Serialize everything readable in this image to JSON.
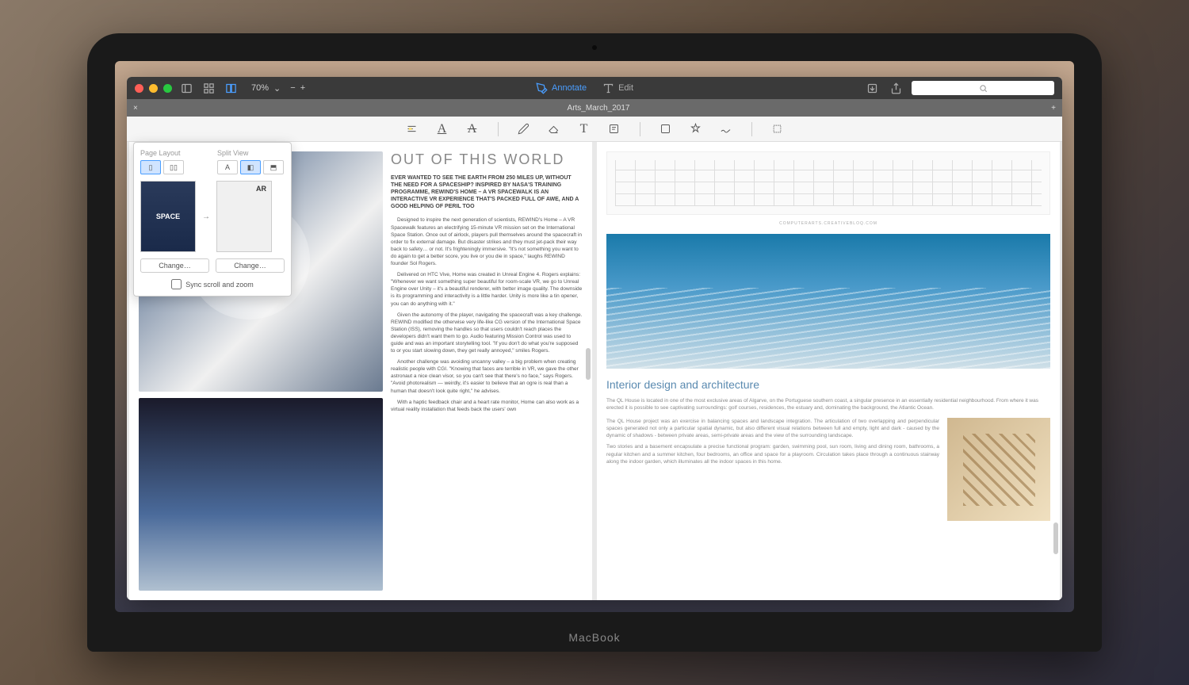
{
  "titlebar": {
    "zoom": "70%",
    "annotate_label": "Annotate",
    "edit_label": "Edit"
  },
  "tabbar": {
    "document_title": "Arts_March_2017"
  },
  "search": {
    "placeholder": ""
  },
  "dropdown": {
    "page_layout_label": "Page Layout",
    "split_view_label": "Split View",
    "thumb_left_label": "SPACE",
    "thumb_right_label": "AR",
    "change_label": "Change…",
    "sync_label": "Sync scroll and zoom"
  },
  "left_article": {
    "title": "OUT OF THIS WORLD",
    "lead": "EVER WANTED TO SEE THE EARTH FROM 250 MILES UP, WITHOUT THE NEED FOR A SPACESHIP? INSPIRED BY NASA'S TRAINING PROGRAMME, REWIND'S HOME – A VR SPACEWALK IS AN INTERACTIVE VR EXPERIENCE THAT'S PACKED FULL OF AWE, AND A GOOD HELPING OF PERIL TOO",
    "p1": "Designed to inspire the next generation of scientists, REWIND's Home – A VR Spacewalk features an electrifying 15-minute VR mission set on the International Space Station. Once out of airlock, players pull themselves around the spacecraft in order to fix external damage. But disaster strikes and they must jet-pack their way back to safety… or not. It's frighteningly immersive. \"It's not something you want to do again to get a better score, you live or you die in space,\" laughs REWIND founder Sol Rogers.",
    "p2": "Delivered on HTC Vive, Home was created in Unreal Engine 4. Rogers explains: \"Whenever we want something super beautiful for room-scale VR, we go to Unreal Engine over Unity – it's a beautiful renderer, with better image quality. The downside is its programming and interactivity is a little harder. Unity is more like a tin opener, you can do anything with it.\"",
    "p3": "Given the autonomy of the player, navigating the spacecraft was a key challenge. REWIND modified the otherwise very life-like CG version of the International Space Station (ISS), removing the handles so that users couldn't reach places the developers didn't want them to go. Audio featuring Mission Control was used to guide and was an important storytelling tool. \"If you don't do what you're supposed to or you start slowing down, they get really annoyed,\" smiles Rogers.",
    "p4": "Another challenge was avoiding uncanny valley – a big problem when creating realistic people with CGI. \"Knowing that faces are terrible in VR, we gave the other astronaut a nice clean visor, so you can't see that there's no face,\" says Rogers. \"Avoid photorealism — weirdly, it's easier to believe that an ogre is real than a human that doesn't look quite right,\" he advises.",
    "p5": "With a haptic feedback chair and a heart rate monitor, Home can also work as a virtual reality installation that feeds back the users' own"
  },
  "right_article": {
    "caption": "COMPUTERARTS.CREATIVEBLOQ.COM",
    "heading": "Interior design and architecture",
    "intro": "The QL House is located in one of the most exclusive areas of Algarve, on the Portuguese southern coast, a singular presence in an essentially residential neighbourhood. From where it was erected it is possible to see captivating surroundings: golf courses, residences, the estuary and, dominating the background, the Atlantic Ocean.",
    "col1": "The QL House project was an exercise in balancing spaces and landscape integration. The articulation of two overlapping and perpendicular spaces generated not only a particular spatial dynamic, but also different visual relations between full and empty, light and dark - caused by the dynamic of shadows - between private areas, semi-private areas and the view of the surrounding landscape.",
    "col2": "Two stories and a basement encapsulate a precise functional program: garden, swimming pool, sun room, living and dining room, bathrooms, a regular kitchen and a summer kitchen, four bedrooms, an office and space for a playroom. Circulation takes place through a continuous stairway along the indoor garden, which illuminates all the indoor spaces in this home."
  }
}
